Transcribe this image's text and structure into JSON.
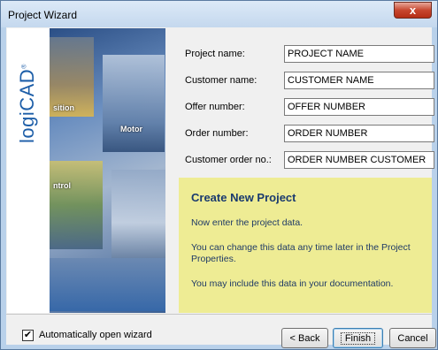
{
  "window": {
    "title": "Project Wizard",
    "close_glyph": "x"
  },
  "banner": {
    "logo_text": "logiCAD",
    "logo_mark": "®",
    "photo_labels": [
      "sition",
      "Motor",
      "ntrol"
    ]
  },
  "form": {
    "fields": [
      {
        "label": "Project name:",
        "value": "PROJECT NAME"
      },
      {
        "label": "Customer name:",
        "value": "CUSTOMER NAME"
      },
      {
        "label": "Offer number:",
        "value": "OFFER NUMBER"
      },
      {
        "label": "Order number:",
        "value": "ORDER NUMBER"
      },
      {
        "label": "Customer order no.:",
        "value": "ORDER NUMBER CUSTOMER"
      }
    ]
  },
  "info": {
    "title": "Create New Project",
    "lines": [
      "Now enter the project data.",
      "You can change this data any time later in the Project Properties.",
      "You may include this data in your documentation."
    ]
  },
  "footer": {
    "checkbox_label": "Automatically open wizard",
    "checkbox_checked": true,
    "back_label": "< Back",
    "finish_label": "Finish",
    "cancel_label": "Cancel"
  },
  "colors": {
    "info_background": "#eeec94",
    "logo_blue": "#1d5ea8",
    "close_red": "#c7472f"
  }
}
